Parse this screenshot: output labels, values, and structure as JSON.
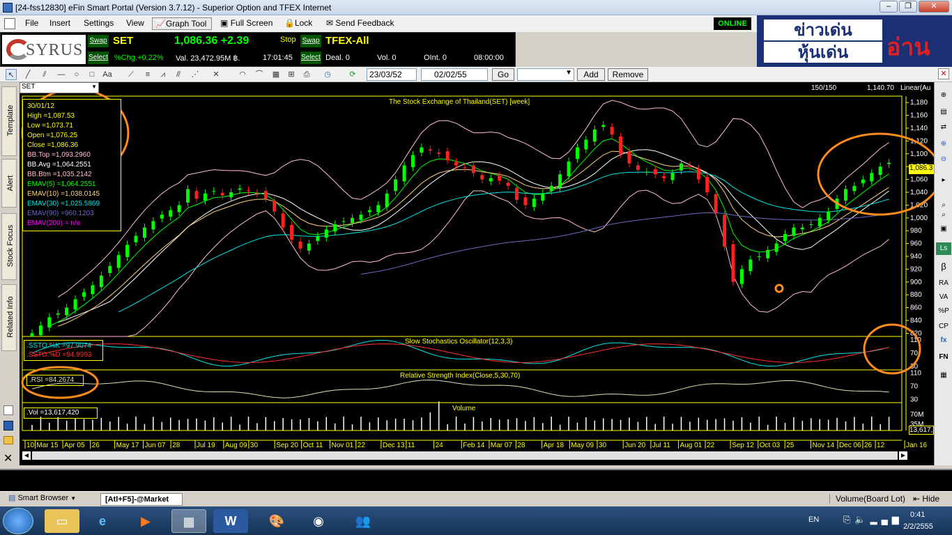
{
  "window": {
    "title": "[24-fss12830] eFin Smart Portal (Version 3.7.12) - Superior Option and TFEX Internet"
  },
  "menu": [
    "File",
    "Insert",
    "Settings",
    "View"
  ],
  "toolbar": {
    "graph_tool": "Graph Tool",
    "full_screen": "Full Screen",
    "lock": "Lock",
    "send_feedback": "Send Feedback",
    "online": "ONLINE"
  },
  "ticker": {
    "logo": "SYRUS",
    "swap": "Swap",
    "select": "Select",
    "symbol": "SET",
    "price": "1,086.36 +2.39",
    "stop": "Stop",
    "pct_chg": "%Chg.+0.22%",
    "value": "Val. 23,472.95M ฿.",
    "time": "17:01:45",
    "tfex_symbol": "TFEX-All",
    "deal": "Deal. 0",
    "vol": "Vol. 0",
    "oint": "OInt. 0",
    "tfex_time": "08:00:00"
  },
  "banner": {
    "line1": "ข่าวเด่น",
    "line2": "หุ้นเด่น",
    "right": "อ่าน"
  },
  "graphbar": {
    "date_from": "23/03/52",
    "date_to": "02/02/55",
    "go": "Go",
    "add": "Add",
    "remove": "Remove"
  },
  "chart_header": {
    "symbol": "SET",
    "bars": "150/150",
    "last_value": "1,140.70",
    "scale": "Linear(Au"
  },
  "left_tabs": [
    "Template",
    "Alert",
    "Stock Focus",
    "Related Info"
  ],
  "right_icons": [
    "Ls",
    "β",
    "RA",
    "VA",
    "%P",
    "CP",
    "fx",
    "FN"
  ],
  "info_box": {
    "date": "30/01/12",
    "lines": [
      {
        "text": "High  =1,087.53",
        "color": "#ffff00"
      },
      {
        "text": "Low  =1,073.71",
        "color": "#ffff00"
      },
      {
        "text": "Open  =1,076.25",
        "color": "#ffff00"
      },
      {
        "text": "Close  =1,086.36",
        "color": "#ffff00"
      },
      {
        "text": "BB.Top  =1,093.2960",
        "color": "#ffc0cb"
      },
      {
        "text": "BB.Avg  =1,064.2551",
        "color": "#ffffff"
      },
      {
        "text": "BB.Btm  =1,035.2142",
        "color": "#ffc0cb"
      },
      {
        "text": "EMAV(5)  =1,064.2551",
        "color": "#00ff00"
      },
      {
        "text": "EMAV(10)  =1,038.0145",
        "color": "#ffd27f"
      },
      {
        "text": "EMAV(30)  =1,025.5869",
        "color": "#00e5e5"
      },
      {
        "text": "EMAV(90)  =960.1203",
        "color": "#6b6bc4"
      },
      {
        "text": "EMAV(200)  = n/a",
        "color": "#ff00ff"
      }
    ]
  },
  "chart_data": [
    {
      "type": "candlestick",
      "title": "The Stock Exchange of Thailand(SET) [week]",
      "ylim": [
        815,
        1190
      ],
      "y_ticks": [
        "1,180",
        "1,160",
        "1,140",
        "1,120",
        "1,100",
        "1,080",
        "1,060",
        "1,040",
        "1,020",
        "1,000",
        "980",
        "960",
        "940",
        "920",
        "900",
        "880",
        "860",
        "840",
        "820"
      ],
      "last_label": "1,086.3",
      "closes": [
        820,
        832,
        845,
        851,
        860,
        873,
        884,
        895,
        910,
        925,
        942,
        958,
        972,
        985,
        995,
        1005,
        1012,
        1020,
        1045,
        1030,
        1038,
        1042,
        1035,
        1040,
        1046,
        1042,
        1038,
        1030,
        1010,
        985,
        966,
        952,
        960,
        972,
        982,
        990,
        995,
        1000,
        1005,
        1012,
        1020,
        1038,
        1060,
        1082,
        1098,
        1110,
        1105,
        1100,
        1090,
        1082,
        1078,
        1070,
        1060,
        1062,
        1058,
        1050,
        1028,
        1020,
        1030,
        1038,
        1050,
        1068,
        1088,
        1110,
        1122,
        1138,
        1145,
        1130,
        1100,
        1085,
        1075,
        1072,
        1068,
        1062,
        1070,
        1085,
        1080,
        1060,
        1040,
        1008,
        955,
        900,
        920,
        935,
        940,
        950,
        960,
        975,
        985,
        985,
        990,
        1000,
        1010,
        1030,
        1045,
        1050,
        1060,
        1070,
        1080,
        1086
      ]
    },
    {
      "type": "line",
      "title": "Slow Stochastics Oscillator(12,3,3)",
      "ylim": [
        20,
        120
      ],
      "y_ticks": [
        "110",
        "70",
        "30"
      ],
      "series": [
        {
          "name": ".SSTO.%K  =97.9074",
          "color": "#00e5e5"
        },
        {
          "name": ".SSTO.%D  =94.9993",
          "color": "#ff3030"
        }
      ]
    },
    {
      "type": "line",
      "title": "Relative Strength Index(Close,5,30,70)",
      "ylim": [
        20,
        120
      ],
      "y_ticks": [
        "110",
        "70",
        "30"
      ],
      "series": [
        {
          "name": ".RSI  =84.2674",
          "color": "#e0e0b0"
        }
      ]
    },
    {
      "type": "bar",
      "title": "Volume",
      "y_ticks": [
        "70M",
        "35M"
      ],
      "series": [
        {
          "name": ".Vol  =13,617,420",
          "color": "#ffffff"
        }
      ],
      "last_label": "13,617,"
    }
  ],
  "x_axis": [
    {
      "label": "10",
      "f": 0.0
    },
    {
      "label": "Mar 15",
      "f": 0.012
    },
    {
      "label": "Apr 05",
      "f": 0.045
    },
    {
      "label": "26",
      "f": 0.078
    },
    {
      "label": "May 17",
      "f": 0.107
    },
    {
      "label": "Jun 07",
      "f": 0.141
    },
    {
      "label": "28",
      "f": 0.174
    },
    {
      "label": "Jul 19",
      "f": 0.203
    },
    {
      "label": "Aug 09",
      "f": 0.237
    },
    {
      "label": "30",
      "f": 0.267
    },
    {
      "label": "Sep 20",
      "f": 0.298
    },
    {
      "label": "Oct 11",
      "f": 0.33
    },
    {
      "label": "Nov 01",
      "f": 0.364
    },
    {
      "label": "22",
      "f": 0.395
    },
    {
      "label": "Dec 13",
      "f": 0.425
    },
    {
      "label": "11",
      "f": 0.455
    },
    {
      "label": "24",
      "f": 0.488
    },
    {
      "label": "Feb 14",
      "f": 0.521
    },
    {
      "label": "Mar 07",
      "f": 0.554
    },
    {
      "label": "28",
      "f": 0.586
    },
    {
      "label": "Apr 18",
      "f": 0.617
    },
    {
      "label": "May 09",
      "f": 0.65
    },
    {
      "label": "30",
      "f": 0.683
    },
    {
      "label": "Jun 20",
      "f": 0.714
    },
    {
      "label": "Jul 11",
      "f": 0.747
    },
    {
      "label": "Aug 01",
      "f": 0.78
    },
    {
      "label": "22",
      "f": 0.812
    },
    {
      "label": "Sep 12",
      "f": 0.842
    },
    {
      "label": "Oct 03",
      "f": 0.875
    },
    {
      "label": "25",
      "f": 0.907
    },
    {
      "label": "Nov 14",
      "f": 0.938
    },
    {
      "label": "Dec 06",
      "f": 0.97
    },
    {
      "label": "26",
      "f": 1.0
    },
    {
      "label": "12",
      "f": 1.015
    },
    {
      "label": "Jan 16",
      "f": 1.05
    }
  ],
  "bottom_tabs": {
    "smart_browser": "Smart Browser",
    "market": "[Atl+F5]-@Market",
    "volume_board": "Volume(Board Lot)",
    "hide": "Hide"
  },
  "taskbar": {
    "lang": "EN",
    "time": "0:41",
    "date": "2/2/2555"
  }
}
